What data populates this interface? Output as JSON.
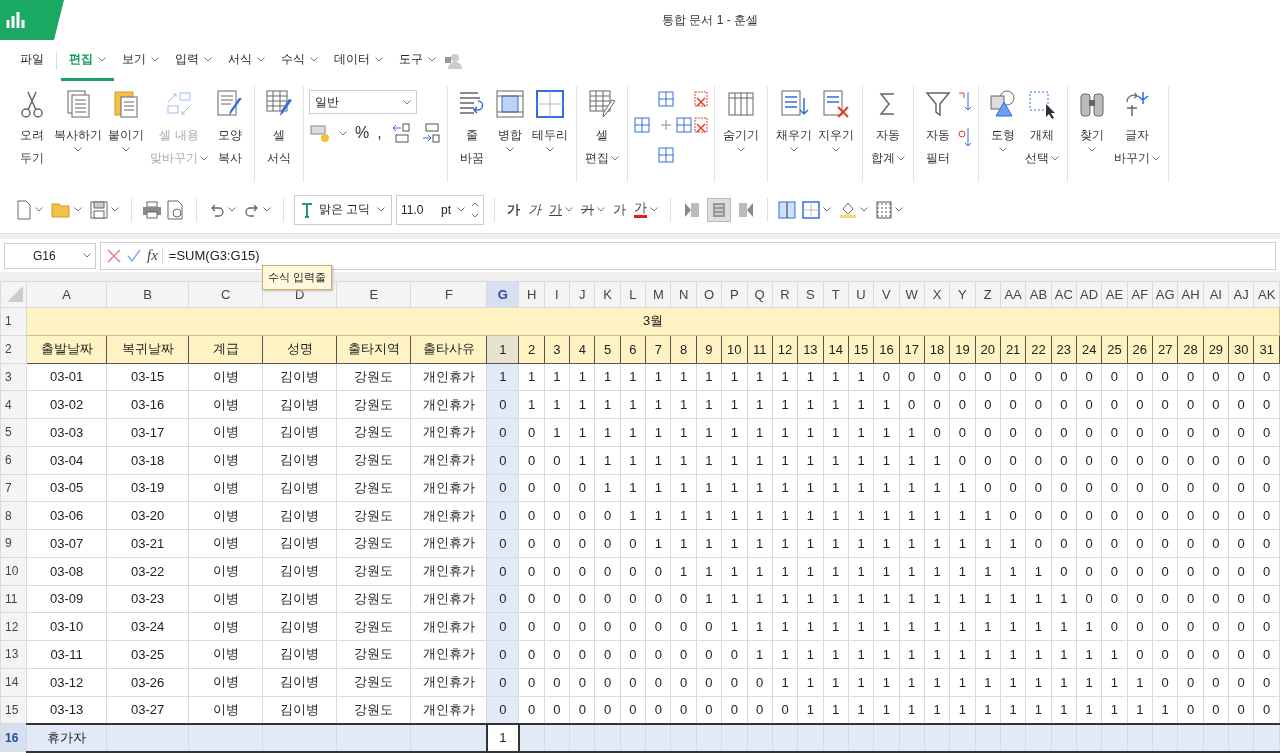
{
  "app": {
    "title": "통합 문서 1 - 훈셀"
  },
  "menu": [
    {
      "label": "파일",
      "selected": false,
      "dropdown": false
    },
    {
      "label": "편집",
      "selected": true,
      "dropdown": true
    },
    {
      "label": "보기",
      "selected": false,
      "dropdown": true
    },
    {
      "label": "입력",
      "selected": false,
      "dropdown": true
    },
    {
      "label": "서식",
      "selected": false,
      "dropdown": true
    },
    {
      "label": "수식",
      "selected": false,
      "dropdown": true
    },
    {
      "label": "데이터",
      "selected": false,
      "dropdown": true
    },
    {
      "label": "도구",
      "selected": false,
      "dropdown": true
    }
  ],
  "ribbon": [
    {
      "items": [
        {
          "kind": "large",
          "lines": [
            "오려",
            "두기"
          ],
          "dropdown": false,
          "disabled": false
        },
        {
          "kind": "large",
          "lines": [
            "복사하기"
          ],
          "dropdown": true,
          "disabled": false
        },
        {
          "kind": "large",
          "lines": [
            "붙이기"
          ],
          "dropdown": true,
          "disabled": false
        },
        {
          "kind": "large",
          "lines": [
            "셀 내용",
            "맞바꾸기"
          ],
          "dropdown": true,
          "disabled": true
        },
        {
          "kind": "large",
          "lines": [
            "모양",
            "복사"
          ],
          "dropdown": false,
          "disabled": false
        }
      ]
    },
    {
      "items": [
        {
          "kind": "large",
          "lines": [
            "셀",
            "서식"
          ],
          "dropdown": false,
          "disabled": false
        }
      ]
    },
    {
      "items": [
        {
          "kind": "format",
          "value": "일반",
          "symbols": [
            "%",
            ","
          ]
        }
      ]
    },
    {
      "items": [
        {
          "kind": "large",
          "lines": [
            "줄",
            "바꿈"
          ],
          "dropdown": false,
          "disabled": false
        },
        {
          "kind": "large",
          "lines": [
            "병합"
          ],
          "dropdown": true,
          "disabled": false
        },
        {
          "kind": "large",
          "lines": [
            "테두리"
          ],
          "dropdown": true,
          "disabled": false
        }
      ]
    },
    {
      "items": [
        {
          "kind": "large",
          "lines": [
            "셀",
            "편집"
          ],
          "dropdown": true,
          "disabled": false
        }
      ]
    },
    {
      "items": [
        {
          "kind": "cluster"
        }
      ]
    },
    {
      "items": [
        {
          "kind": "large",
          "lines": [
            "숨기기"
          ],
          "dropdown": true,
          "disabled": false
        }
      ]
    },
    {
      "items": [
        {
          "kind": "large",
          "lines": [
            "채우기"
          ],
          "dropdown": true,
          "disabled": false
        },
        {
          "kind": "large",
          "lines": [
            "지우기"
          ],
          "dropdown": true,
          "disabled": false
        }
      ]
    },
    {
      "items": [
        {
          "kind": "large",
          "lines": [
            "자동",
            "합계"
          ],
          "dropdown": true,
          "disabled": false
        }
      ]
    },
    {
      "items": [
        {
          "kind": "large",
          "lines": [
            "자동",
            "필터"
          ],
          "dropdown": false,
          "disabled": false
        },
        {
          "kind": "sort"
        }
      ]
    },
    {
      "items": [
        {
          "kind": "large",
          "lines": [
            "도형"
          ],
          "dropdown": true,
          "disabled": false
        },
        {
          "kind": "large",
          "lines": [
            "개체",
            "선택"
          ],
          "dropdown": true,
          "disabled": false
        }
      ]
    },
    {
      "items": [
        {
          "kind": "large",
          "lines": [
            "찾기"
          ],
          "dropdown": true,
          "disabled": false
        },
        {
          "kind": "large",
          "lines": [
            "글자",
            "바꾸기"
          ],
          "dropdown": true,
          "disabled": false
        }
      ]
    }
  ],
  "toolbar": {
    "font": "맑은 고딕",
    "size": "11.0",
    "unit": "pt",
    "text_styles": [
      {
        "kind": "bold",
        "label": "가",
        "dropdown": false
      },
      {
        "kind": "italic",
        "label": "가",
        "dropdown": false
      },
      {
        "kind": "underline",
        "label": "가",
        "dropdown": true
      },
      {
        "kind": "strike",
        "label": "가",
        "dropdown": true
      },
      {
        "kind": "plain",
        "label": "가",
        "dropdown": false
      },
      {
        "kind": "color",
        "label": "가",
        "dropdown": true
      }
    ],
    "align": [
      {
        "selected": false
      },
      {
        "selected": true
      },
      {
        "selected": false
      }
    ]
  },
  "formula_bar": {
    "cell": "G16",
    "fx": "fx",
    "formula": "=SUM(G3:G15)",
    "tooltip": "수식 입력줄"
  },
  "sheet": {
    "columns": [
      {
        "label": "A",
        "selected": false
      },
      {
        "label": "B",
        "selected": false
      },
      {
        "label": "C",
        "selected": false
      },
      {
        "label": "D",
        "selected": false
      },
      {
        "label": "E",
        "selected": false
      },
      {
        "label": "F",
        "selected": false
      },
      {
        "label": "G",
        "selected": true
      },
      {
        "label": "H",
        "selected": false
      },
      {
        "label": "I",
        "selected": false
      },
      {
        "label": "J",
        "selected": false
      },
      {
        "label": "K",
        "selected": false
      },
      {
        "label": "L",
        "selected": false
      },
      {
        "label": "M",
        "selected": false
      },
      {
        "label": "N",
        "selected": false
      },
      {
        "label": "O",
        "selected": false
      },
      {
        "label": "P",
        "selected": false
      },
      {
        "label": "Q",
        "selected": false
      },
      {
        "label": "R",
        "selected": false
      },
      {
        "label": "S",
        "selected": false
      },
      {
        "label": "T",
        "selected": false
      },
      {
        "label": "U",
        "selected": false
      },
      {
        "label": "V",
        "selected": false
      },
      {
        "label": "W",
        "selected": false
      },
      {
        "label": "X",
        "selected": false
      },
      {
        "label": "Y",
        "selected": false
      },
      {
        "label": "Z",
        "selected": false
      },
      {
        "label": "AA",
        "selected": false
      },
      {
        "label": "AB",
        "selected": false
      },
      {
        "label": "AC",
        "selected": false
      },
      {
        "label": "AD",
        "selected": false
      },
      {
        "label": "AE",
        "selected": false
      },
      {
        "label": "AF",
        "selected": false
      },
      {
        "label": "AG",
        "selected": false
      },
      {
        "label": "AH",
        "selected": false
      },
      {
        "label": "AI",
        "selected": false
      },
      {
        "label": "AJ",
        "selected": false
      },
      {
        "label": "AK",
        "selected": false
      }
    ],
    "rows": [
      {
        "number": "1",
        "kind": "band",
        "selected": false,
        "title": "3월"
      },
      {
        "number": "2",
        "kind": "header",
        "selected": false,
        "cells": [
          "출발날짜",
          "복귀날짜",
          "계급",
          "성명",
          "출타지역",
          "출타사유",
          "1",
          "2",
          "3",
          "4",
          "5",
          "6",
          "7",
          "8",
          "9",
          "10",
          "11",
          "12",
          "13",
          "14",
          "15",
          "16",
          "17",
          "18",
          "19",
          "20",
          "21",
          "22",
          "23",
          "24",
          "25",
          "26",
          "27",
          "28",
          "29",
          "30",
          "31"
        ]
      },
      {
        "number": "3",
        "kind": "data",
        "selected": false,
        "cells": [
          "03-01",
          "03-15",
          "이병",
          "김이병",
          "강원도",
          "개인휴가",
          "1",
          "1",
          "1",
          "1",
          "1",
          "1",
          "1",
          "1",
          "1",
          "1",
          "1",
          "1",
          "1",
          "1",
          "1",
          "0",
          "0",
          "0",
          "0",
          "0",
          "0",
          "0",
          "0",
          "0",
          "0",
          "0",
          "0",
          "0",
          "0",
          "0",
          "0"
        ]
      },
      {
        "number": "4",
        "kind": "data",
        "selected": false,
        "cells": [
          "03-02",
          "03-16",
          "이병",
          "김이병",
          "강원도",
          "개인휴가",
          "0",
          "1",
          "1",
          "1",
          "1",
          "1",
          "1",
          "1",
          "1",
          "1",
          "1",
          "1",
          "1",
          "1",
          "1",
          "1",
          "0",
          "0",
          "0",
          "0",
          "0",
          "0",
          "0",
          "0",
          "0",
          "0",
          "0",
          "0",
          "0",
          "0",
          "0"
        ]
      },
      {
        "number": "5",
        "kind": "data",
        "selected": false,
        "cells": [
          "03-03",
          "03-17",
          "이병",
          "김이병",
          "강원도",
          "개인휴가",
          "0",
          "0",
          "1",
          "1",
          "1",
          "1",
          "1",
          "1",
          "1",
          "1",
          "1",
          "1",
          "1",
          "1",
          "1",
          "1",
          "1",
          "0",
          "0",
          "0",
          "0",
          "0",
          "0",
          "0",
          "0",
          "0",
          "0",
          "0",
          "0",
          "0",
          "0"
        ]
      },
      {
        "number": "6",
        "kind": "data",
        "selected": false,
        "cells": [
          "03-04",
          "03-18",
          "이병",
          "김이병",
          "강원도",
          "개인휴가",
          "0",
          "0",
          "0",
          "1",
          "1",
          "1",
          "1",
          "1",
          "1",
          "1",
          "1",
          "1",
          "1",
          "1",
          "1",
          "1",
          "1",
          "1",
          "0",
          "0",
          "0",
          "0",
          "0",
          "0",
          "0",
          "0",
          "0",
          "0",
          "0",
          "0",
          "0"
        ]
      },
      {
        "number": "7",
        "kind": "data",
        "selected": false,
        "cells": [
          "03-05",
          "03-19",
          "이병",
          "김이병",
          "강원도",
          "개인휴가",
          "0",
          "0",
          "0",
          "0",
          "1",
          "1",
          "1",
          "1",
          "1",
          "1",
          "1",
          "1",
          "1",
          "1",
          "1",
          "1",
          "1",
          "1",
          "1",
          "0",
          "0",
          "0",
          "0",
          "0",
          "0",
          "0",
          "0",
          "0",
          "0",
          "0",
          "0"
        ]
      },
      {
        "number": "8",
        "kind": "data",
        "selected": false,
        "cells": [
          "03-06",
          "03-20",
          "이병",
          "김이병",
          "강원도",
          "개인휴가",
          "0",
          "0",
          "0",
          "0",
          "0",
          "1",
          "1",
          "1",
          "1",
          "1",
          "1",
          "1",
          "1",
          "1",
          "1",
          "1",
          "1",
          "1",
          "1",
          "1",
          "0",
          "0",
          "0",
          "0",
          "0",
          "0",
          "0",
          "0",
          "0",
          "0",
          "0"
        ]
      },
      {
        "number": "9",
        "kind": "data",
        "selected": false,
        "cells": [
          "03-07",
          "03-21",
          "이병",
          "김이병",
          "강원도",
          "개인휴가",
          "0",
          "0",
          "0",
          "0",
          "0",
          "0",
          "1",
          "1",
          "1",
          "1",
          "1",
          "1",
          "1",
          "1",
          "1",
          "1",
          "1",
          "1",
          "1",
          "1",
          "1",
          "0",
          "0",
          "0",
          "0",
          "0",
          "0",
          "0",
          "0",
          "0",
          "0"
        ]
      },
      {
        "number": "10",
        "kind": "data",
        "selected": false,
        "cells": [
          "03-08",
          "03-22",
          "이병",
          "김이병",
          "강원도",
          "개인휴가",
          "0",
          "0",
          "0",
          "0",
          "0",
          "0",
          "0",
          "1",
          "1",
          "1",
          "1",
          "1",
          "1",
          "1",
          "1",
          "1",
          "1",
          "1",
          "1",
          "1",
          "1",
          "1",
          "0",
          "0",
          "0",
          "0",
          "0",
          "0",
          "0",
          "0",
          "0"
        ]
      },
      {
        "number": "11",
        "kind": "data",
        "selected": false,
        "cells": [
          "03-09",
          "03-23",
          "이병",
          "김이병",
          "강원도",
          "개인휴가",
          "0",
          "0",
          "0",
          "0",
          "0",
          "0",
          "0",
          "0",
          "1",
          "1",
          "1",
          "1",
          "1",
          "1",
          "1",
          "1",
          "1",
          "1",
          "1",
          "1",
          "1",
          "1",
          "1",
          "0",
          "0",
          "0",
          "0",
          "0",
          "0",
          "0",
          "0"
        ]
      },
      {
        "number": "12",
        "kind": "data",
        "selected": false,
        "cells": [
          "03-10",
          "03-24",
          "이병",
          "김이병",
          "강원도",
          "개인휴가",
          "0",
          "0",
          "0",
          "0",
          "0",
          "0",
          "0",
          "0",
          "0",
          "1",
          "1",
          "1",
          "1",
          "1",
          "1",
          "1",
          "1",
          "1",
          "1",
          "1",
          "1",
          "1",
          "1",
          "1",
          "0",
          "0",
          "0",
          "0",
          "0",
          "0",
          "0"
        ]
      },
      {
        "number": "13",
        "kind": "data",
        "selected": false,
        "cells": [
          "03-11",
          "03-25",
          "이병",
          "김이병",
          "강원도",
          "개인휴가",
          "0",
          "0",
          "0",
          "0",
          "0",
          "0",
          "0",
          "0",
          "0",
          "0",
          "1",
          "1",
          "1",
          "1",
          "1",
          "1",
          "1",
          "1",
          "1",
          "1",
          "1",
          "1",
          "1",
          "1",
          "1",
          "0",
          "0",
          "0",
          "0",
          "0",
          "0"
        ]
      },
      {
        "number": "14",
        "kind": "data",
        "selected": false,
        "cells": [
          "03-12",
          "03-26",
          "이병",
          "김이병",
          "강원도",
          "개인휴가",
          "0",
          "0",
          "0",
          "0",
          "0",
          "0",
          "0",
          "0",
          "0",
          "0",
          "0",
          "1",
          "1",
          "1",
          "1",
          "1",
          "1",
          "1",
          "1",
          "1",
          "1",
          "1",
          "1",
          "1",
          "1",
          "1",
          "0",
          "0",
          "0",
          "0",
          "0"
        ]
      },
      {
        "number": "15",
        "kind": "data",
        "selected": false,
        "cells": [
          "03-13",
          "03-27",
          "이병",
          "김이병",
          "강원도",
          "개인휴가",
          "0",
          "0",
          "0",
          "0",
          "0",
          "0",
          "0",
          "0",
          "0",
          "0",
          "0",
          "0",
          "1",
          "1",
          "1",
          "1",
          "1",
          "1",
          "1",
          "1",
          "1",
          "1",
          "1",
          "1",
          "1",
          "1",
          "1",
          "0",
          "0",
          "0",
          "0"
        ]
      },
      {
        "number": "16",
        "kind": "total",
        "selected": true,
        "label": "휴가자",
        "sum": "1"
      }
    ]
  }
}
